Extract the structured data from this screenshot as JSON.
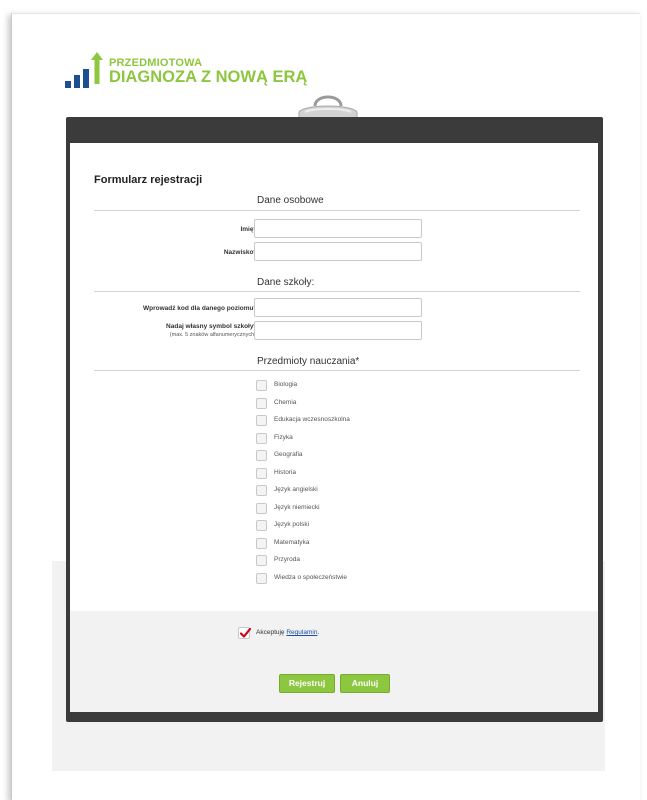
{
  "logo": {
    "line1": "PRZEDMIOTOWA",
    "line2": "DIAGNOZA Z NOWĄ ERĄ"
  },
  "form": {
    "title": "Formularz rejestracji",
    "personal": {
      "section_title": "Dane osobowe",
      "first_name_label": "Imię*",
      "first_name_value": "",
      "last_name_label": "Nazwisko*",
      "last_name_value": ""
    },
    "school": {
      "section_title": "Dane szkoły:",
      "code_label": "Wprowadź kod dla danego poziomu*",
      "code_value": "",
      "symbol_label": "Nadaj własny symbol szkoły*",
      "symbol_hint": "(max. 5 znaków alfanumerycznych)",
      "symbol_value": ""
    },
    "subjects": {
      "section_title": "Przedmioty nauczania*",
      "items": [
        {
          "label": "Biologia",
          "checked": false
        },
        {
          "label": "Chemia",
          "checked": false
        },
        {
          "label": "Edukacja wczesnoszkolna",
          "checked": false
        },
        {
          "label": "Fizyka",
          "checked": false
        },
        {
          "label": "Geografia",
          "checked": false
        },
        {
          "label": "Historia",
          "checked": false
        },
        {
          "label": "Język angielski",
          "checked": false
        },
        {
          "label": "Język niemiecki",
          "checked": false
        },
        {
          "label": "Język polski",
          "checked": false
        },
        {
          "label": "Matematyka",
          "checked": false
        },
        {
          "label": "Przyroda",
          "checked": false
        },
        {
          "label": "Wiedza o społeczeństwie",
          "checked": false
        }
      ]
    },
    "terms": {
      "checked": true,
      "text": "Akceptuję",
      "link": "Regulamin",
      "suffix": "."
    },
    "buttons": {
      "register": "Rejestruj",
      "cancel": "Anuluj"
    }
  },
  "colors": {
    "brand_green": "#8dc63f",
    "brand_blue": "#1d4f91",
    "board": "#3b3b3b",
    "check_red": "#d0021b",
    "link": "#1a4ea8"
  }
}
